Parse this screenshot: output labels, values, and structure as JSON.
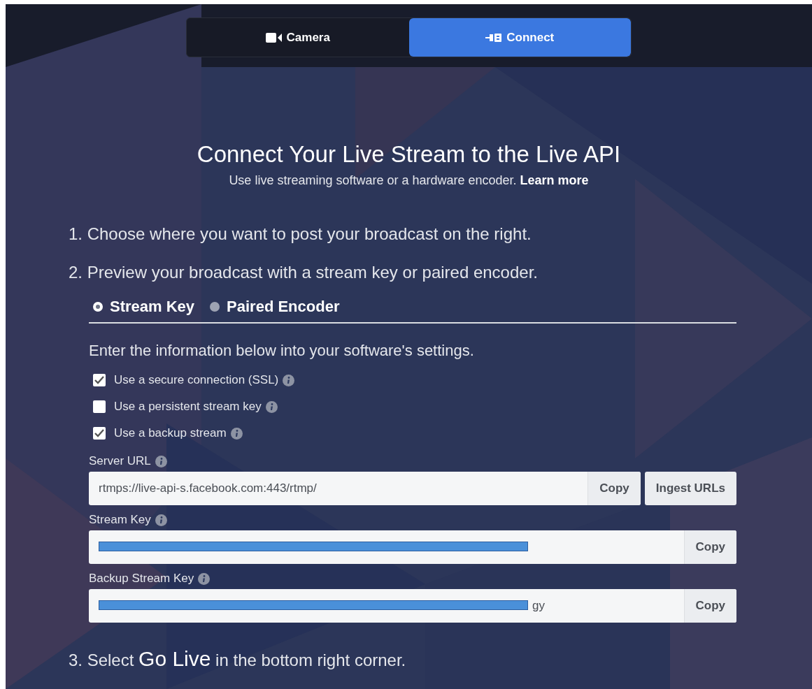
{
  "tabs": [
    {
      "label": "Camera",
      "selected": false
    },
    {
      "label": "Connect",
      "selected": true
    }
  ],
  "title": "Connect Your Live Stream to the Live API",
  "subtitle": "Use live streaming software or a hardware encoder. **Learn more**",
  "steps": [
    {
      "number": "1.",
      "text": "Choose where you want to post your broadcast on the right."
    },
    {
      "number": "2.",
      "text": "Preview your broadcast with a stream key or paired encoder."
    }
  ],
  "modes": [
    {
      "label": "Stream Key",
      "selected": true
    },
    {
      "label": "Paired Encoder",
      "selected": false
    }
  ],
  "instructions": "Enter the information below into your software's settings.",
  "options": [
    {
      "label": "Use a secure connection (SSL)",
      "checked": true
    },
    {
      "label": "Use a persistent stream key",
      "checked": false
    },
    {
      "label": "Use a backup stream",
      "checked": true
    }
  ],
  "fields": [
    {
      "label": "Server URL",
      "value": "rtmps://live-api-s.facebook.com:443/rtmp/",
      "redacted": false,
      "buttons": [
        "Copy",
        "Ingest URLs"
      ]
    },
    {
      "label": "Stream Key",
      "redacted": true,
      "buttons": [
        "Copy"
      ]
    },
    {
      "label": "Backup Stream Key",
      "value": "gy",
      "redacted": true,
      "buttons": [
        "Copy"
      ]
    }
  ],
  "final_step": {
    "number": "3.",
    "text": "Select **Go Live** in the bottom right corner."
  }
}
